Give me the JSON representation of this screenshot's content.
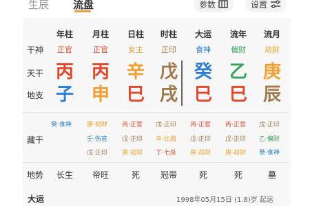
{
  "tabs": [
    "生辰",
    "流盘"
  ],
  "params_label": "参数",
  "settings_label": "设置",
  "columns": [
    "年柱",
    "月柱",
    "日柱",
    "时柱",
    "大运",
    "流年",
    "流月"
  ],
  "row_labels": {
    "shishen": "干神",
    "tiangan": "天干",
    "dizhi": "地支",
    "canggan": "藏干",
    "dishi": "地势"
  },
  "shishen": [
    "正官",
    "正官",
    "女主",
    "正印",
    "食神",
    "偏财",
    "劫财"
  ],
  "tiangan": [
    "丙",
    "丙",
    "辛",
    "戊",
    "癸",
    "乙",
    "庚"
  ],
  "dizhi": [
    "子",
    "申",
    "巳",
    "戌",
    "巳",
    "巳",
    "辰"
  ],
  "canggan": [
    [
      "癸·食神"
    ],
    [
      "庚·劫财",
      "壬·伤官",
      "戊·正印"
    ],
    [
      "丙·正官",
      "戊·正印",
      "庚·劫财"
    ],
    [
      "戊·正印",
      "辛·比肩",
      "丁·七杀"
    ],
    [
      "丙·正官",
      "戊·正印",
      "庚·劫财"
    ],
    [
      "丙·正官",
      "戊·正印",
      "庚·劫财"
    ],
    [
      "戊·正印",
      "乙·偏财",
      "癸·食神"
    ]
  ],
  "dishi": [
    "长生",
    "帝旺",
    "死",
    "冠带",
    "死",
    "死",
    "墓"
  ],
  "bottom": {
    "title": "大运",
    "info": "1998年05月15日 (1.8)岁 起运"
  },
  "colors": {
    "red": "#e2472b",
    "blue": "#2c7fd6",
    "orange": "#f0a030",
    "brown": "#a07a4a",
    "green": "#3aa35c",
    "gray": "#888888"
  }
}
